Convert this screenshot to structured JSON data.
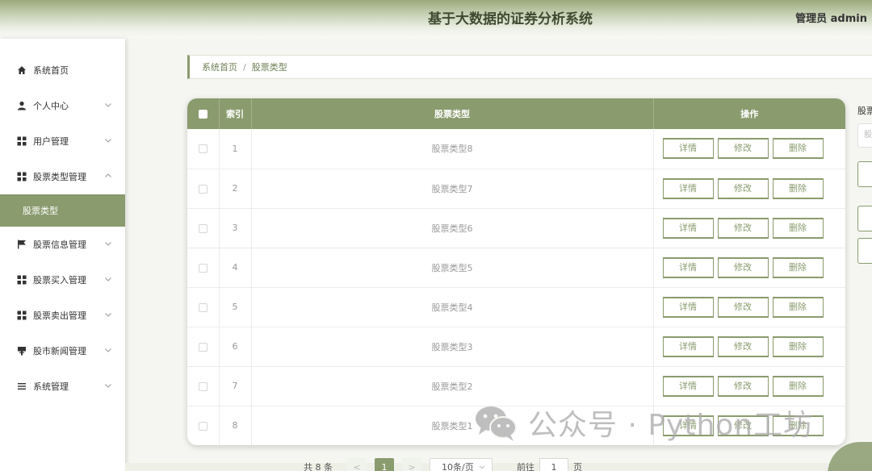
{
  "header": {
    "title": "基于大数据的证券分析系统",
    "user": "管理员 admin"
  },
  "sidebar": {
    "items": [
      {
        "label": "系统首页",
        "icon": "home-icon"
      },
      {
        "label": "个人中心",
        "icon": "person-icon"
      },
      {
        "label": "用户管理",
        "icon": "grid-icon"
      },
      {
        "label": "股票类型管理",
        "icon": "grid-icon"
      },
      {
        "label": "股票类型",
        "icon": ""
      },
      {
        "label": "股票信息管理",
        "icon": "flag-icon"
      },
      {
        "label": "股票买入管理",
        "icon": "grid-icon"
      },
      {
        "label": "股票卖出管理",
        "icon": "grid-icon"
      },
      {
        "label": "股市新闻管理",
        "icon": "news-icon"
      },
      {
        "label": "系统管理",
        "icon": "list-icon"
      }
    ]
  },
  "breadcrumb": {
    "home": "系统首页",
    "separator": "/",
    "current": "股票类型"
  },
  "table": {
    "headers": {
      "index": "索引",
      "type": "股票类型",
      "actions": "操作"
    },
    "actions": {
      "detail": "详情",
      "edit": "修改",
      "delete": "删除"
    },
    "rows": [
      {
        "index": "1",
        "type": "股票类型8"
      },
      {
        "index": "2",
        "type": "股票类型7"
      },
      {
        "index": "3",
        "type": "股票类型6"
      },
      {
        "index": "4",
        "type": "股票类型5"
      },
      {
        "index": "5",
        "type": "股票类型4"
      },
      {
        "index": "6",
        "type": "股票类型3"
      },
      {
        "index": "7",
        "type": "股票类型2"
      },
      {
        "index": "8",
        "type": "股票类型1"
      }
    ]
  },
  "right_panel": {
    "label": "股票",
    "placeholder": "股"
  },
  "pagination": {
    "total": "共 8 条",
    "prev": "<",
    "current_page": "1",
    "next": ">",
    "page_size": "10条/页",
    "goto_label": "前往",
    "goto_value": "1",
    "goto_suffix": "页"
  },
  "watermark": {
    "text": "公众号 · Python工坊"
  },
  "colors": {
    "accent": "#8a9b6e",
    "header_top": "#9aaa7c",
    "title_text": "#3f4a30"
  }
}
